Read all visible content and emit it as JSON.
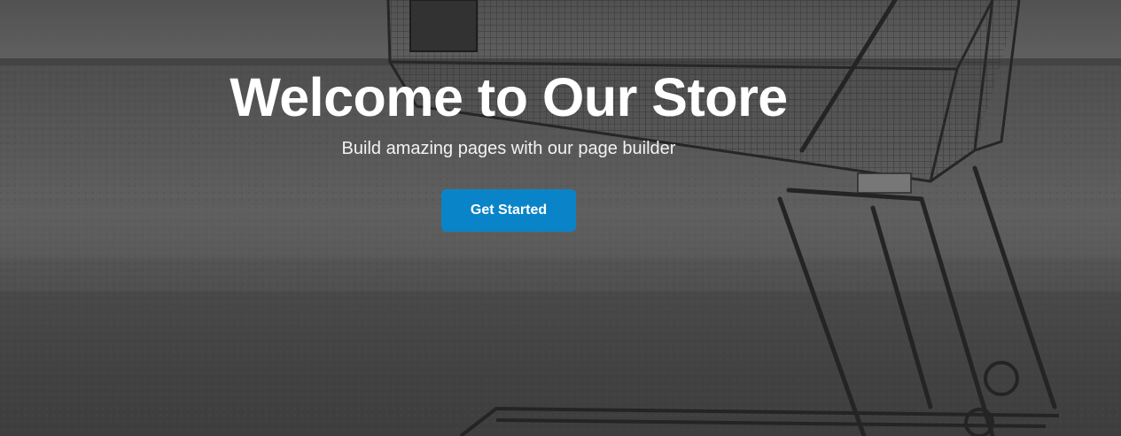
{
  "hero": {
    "title": "Welcome to Our Store",
    "subtitle": "Build amazing pages with our page builder",
    "cta_label": "Get Started",
    "background_image": "shopping-cart-on-field-grayscale",
    "colors": {
      "cta_background": "#0a84c8",
      "text": "#ffffff"
    }
  }
}
